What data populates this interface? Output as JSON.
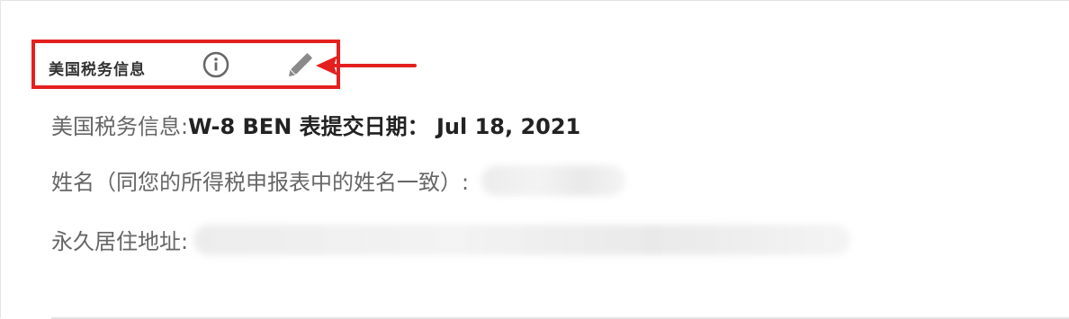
{
  "section": {
    "title": "美国税务信息",
    "info_icon": "info-circle-icon",
    "edit_icon": "pencil-icon"
  },
  "annotation": {
    "highlight_color": "#e4201f",
    "arrow_color": "#e4201f"
  },
  "fields": {
    "tax_info_label": "美国税务信息:",
    "tax_info_value": "W-8 BEN 表提交日期： Jul 18, 2021",
    "name_label": "姓名（同您的所得税申报表中的姓名一致）:",
    "address_label": "永久居住地址:"
  }
}
